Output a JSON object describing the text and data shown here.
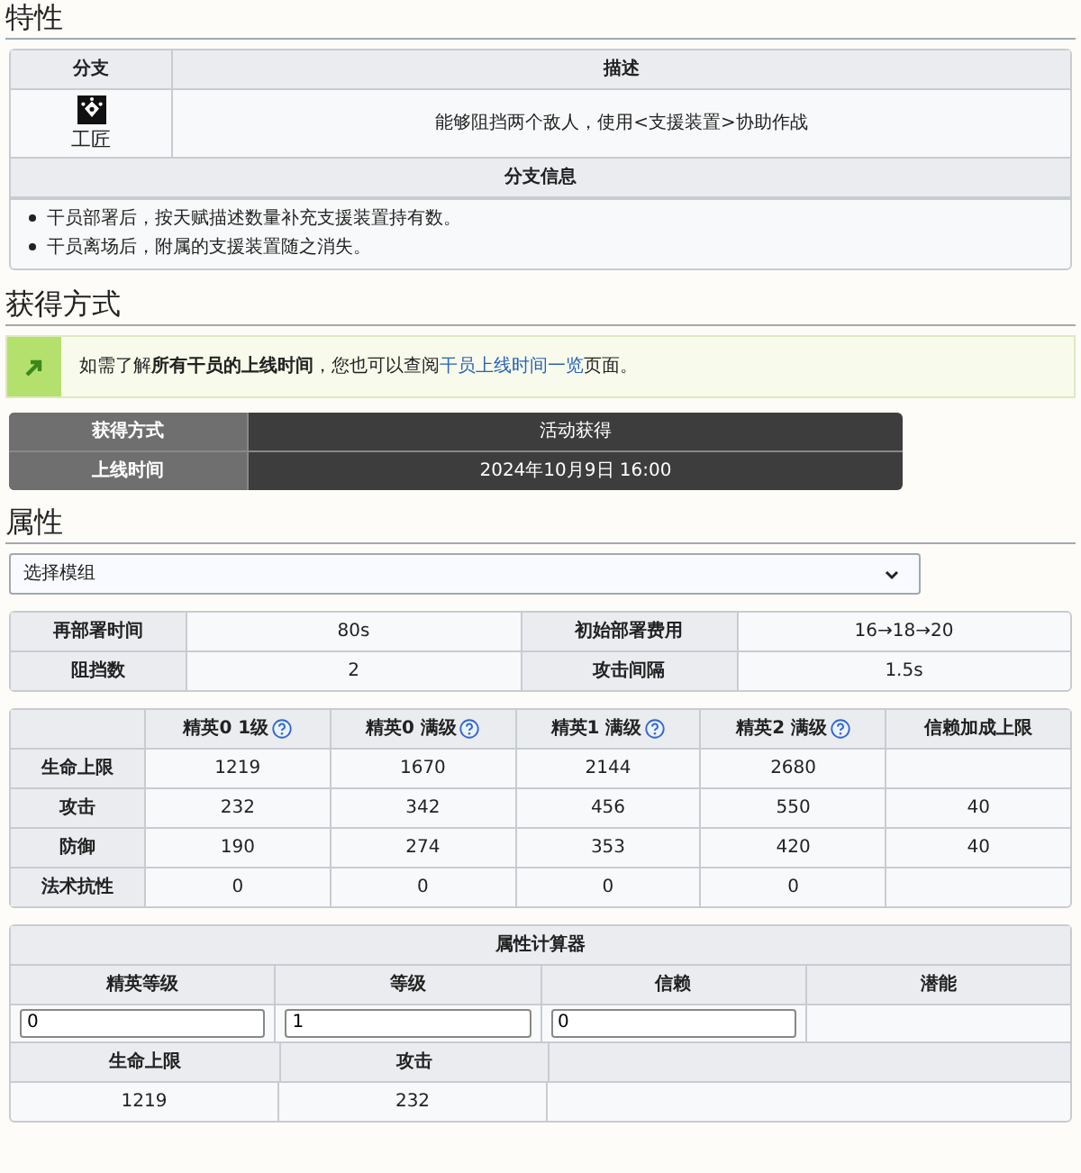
{
  "trait": {
    "heading": "特性",
    "columns": [
      "分支",
      "描述"
    ],
    "branch": "工匠",
    "description": "能够阻挡两个敌人，使用<支援装置>协助作战",
    "info_header": "分支信息",
    "info": [
      "干员部署后，按天赋描述数量补充支援装置持有数。",
      "干员离场后，附属的支援装置随之消失。"
    ]
  },
  "obtain": {
    "heading": "获得方式",
    "notice": {
      "before": "如需了解**所有干员的上线时间**，您也可以查阅",
      "link": "干员上线时间一览",
      "after": "页面。"
    },
    "rows": [
      {
        "label": "获得方式",
        "value": "活动获得"
      },
      {
        "label": "上线时间",
        "value": "2024年10月9日 16:00"
      }
    ]
  },
  "attributes": {
    "heading": "属性",
    "select": "选择模组",
    "stats": [
      [
        "再部署时间",
        "80s",
        "初始部署费用",
        "16→18→20"
      ],
      [
        "阻挡数",
        "2",
        "攻击间隔",
        "1.5s"
      ]
    ],
    "columns": [
      {
        "label": "精英0 1级",
        "help": true
      },
      {
        "label": "精英0 满级",
        "help": true
      },
      {
        "label": "精英1 满级",
        "help": true
      },
      {
        "label": "精英2 满级",
        "help": true
      },
      {
        "label": "信赖加成上限",
        "help": false
      }
    ],
    "rows": [
      {
        "name": "生命上限",
        "values": [
          "1219",
          "1670",
          "2144",
          "2680"
        ]
      },
      {
        "name": "攻击",
        "values": [
          "232",
          "342",
          "456",
          "550"
        ],
        "trust": "40"
      },
      {
        "name": "防御",
        "values": [
          "190",
          "274",
          "353",
          "420"
        ],
        "trust": "40"
      },
      {
        "name": "法术抗性",
        "values": [
          "0",
          "0",
          "0",
          "0"
        ]
      }
    ]
  },
  "calculator": {
    "title": "属性计算器",
    "inputs": [
      {
        "label": "精英等级",
        "value": "0"
      },
      {
        "label": "等级",
        "value": "1"
      },
      {
        "label": "信赖",
        "value": "0"
      },
      {
        "label": "潜能"
      }
    ],
    "results": [
      {
        "label": "生命上限",
        "value": "1219"
      },
      {
        "label": "攻击",
        "value": "232"
      }
    ]
  }
}
